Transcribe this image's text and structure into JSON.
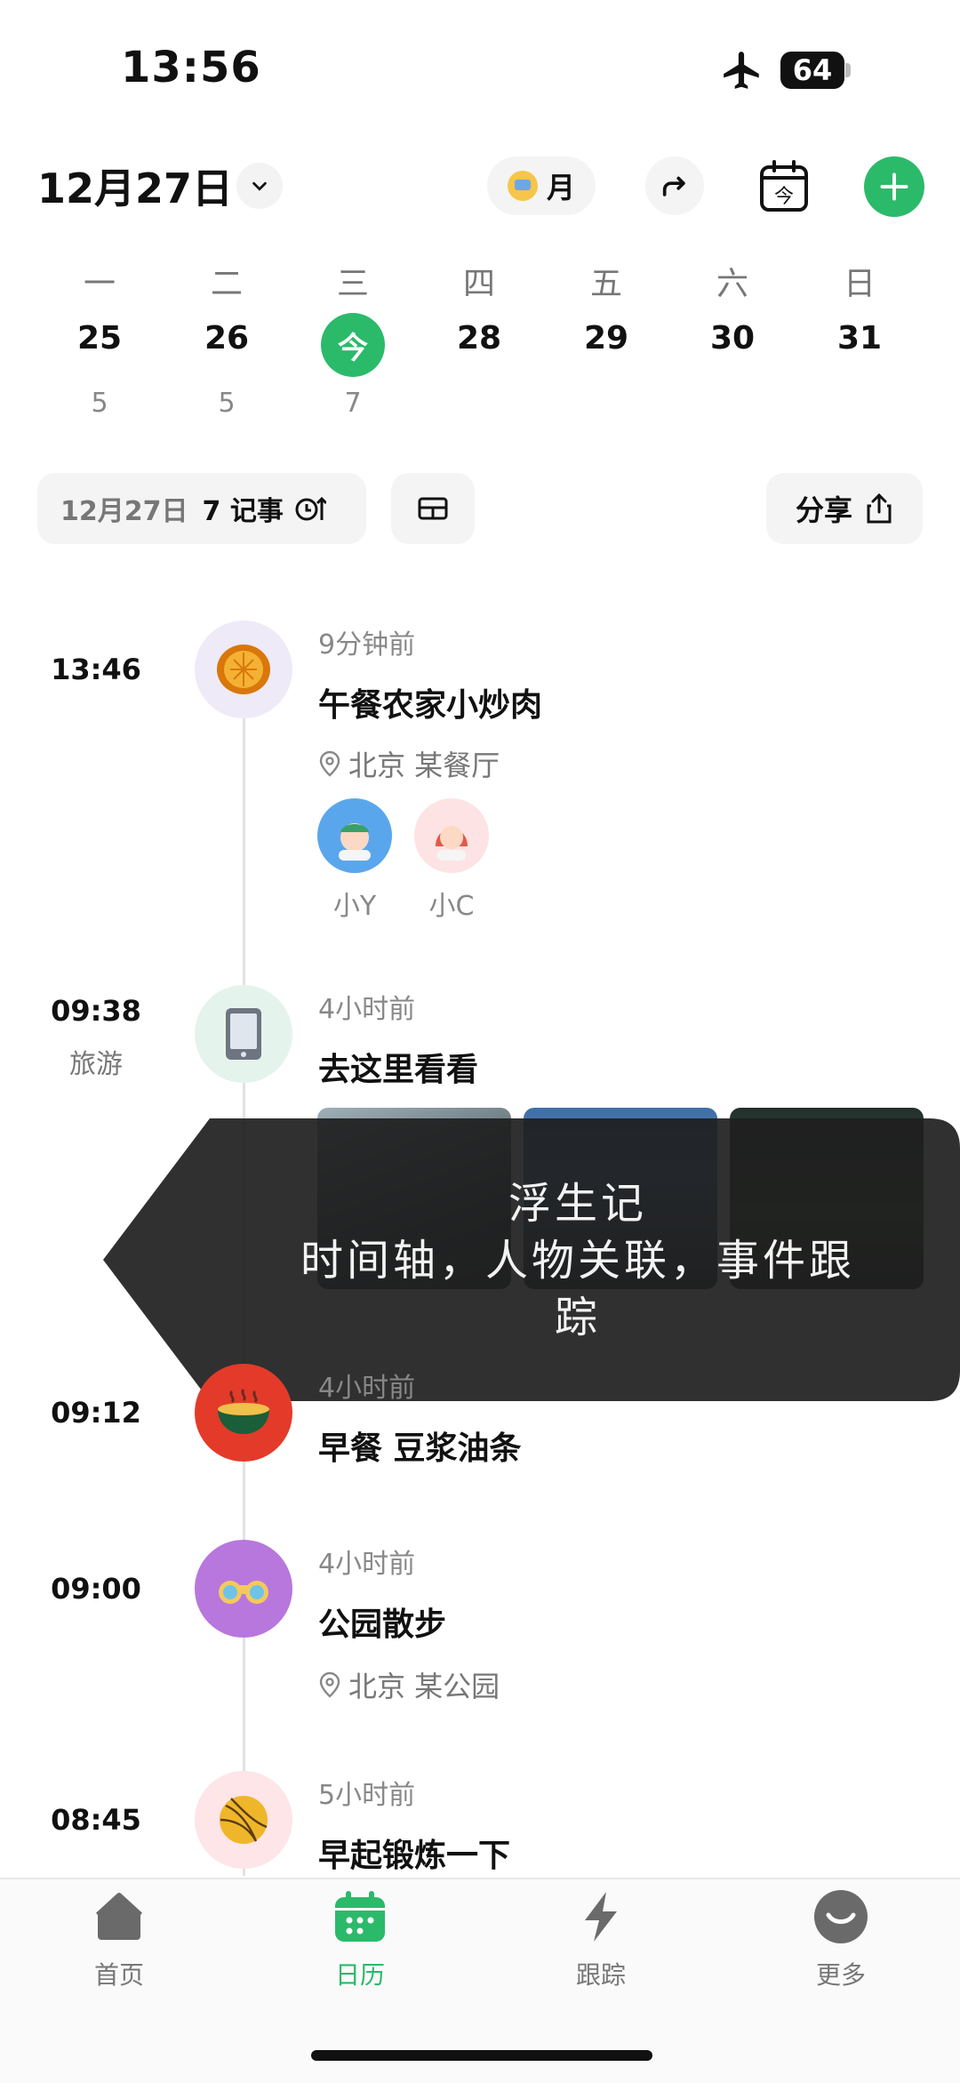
{
  "status": {
    "time": "13:56",
    "battery": "64"
  },
  "header": {
    "date": "12月27日",
    "view_mode": "月",
    "today_icon_text": "今"
  },
  "week": {
    "days": [
      "一",
      "二",
      "三",
      "四",
      "五",
      "六",
      "日"
    ],
    "dates": [
      "25",
      "26",
      "今",
      "28",
      "29",
      "30",
      "31"
    ],
    "counts": [
      "5",
      "5",
      "7",
      "",
      "",
      "",
      ""
    ]
  },
  "summary": {
    "date": "12月27日",
    "count": "7 记事",
    "share_label": "分享"
  },
  "events": [
    {
      "time": "13:46",
      "tag": "",
      "ago": "9分钟前",
      "title": "午餐农家小炒肉",
      "location": "北京 某餐厅",
      "people": [
        {
          "name": "小Y"
        },
        {
          "name": "小C"
        }
      ]
    },
    {
      "time": "09:38",
      "tag": "旅游",
      "ago": "4小时前",
      "title": "去这里看看",
      "location": ""
    },
    {
      "time": "09:12",
      "tag": "",
      "ago": "4小时前",
      "title": "早餐 豆浆油条",
      "location": ""
    },
    {
      "time": "09:00",
      "tag": "",
      "ago": "4小时前",
      "title": "公园散步",
      "location": "北京 某公园"
    },
    {
      "time": "08:45",
      "tag": "",
      "ago": "5小时前",
      "title": "早起锻炼一下",
      "location": ""
    }
  ],
  "banner": {
    "line1": "浮生记",
    "line2": "时间轴，人物关联，事件跟",
    "line3": "踪"
  },
  "nav": [
    {
      "label": "首页",
      "icon": "home-icon"
    },
    {
      "label": "日历",
      "icon": "calendar-icon"
    },
    {
      "label": "跟踪",
      "icon": "bolt-icon"
    },
    {
      "label": "更多",
      "icon": "more-icon"
    }
  ],
  "colors": {
    "accent": "#2bba6a"
  }
}
